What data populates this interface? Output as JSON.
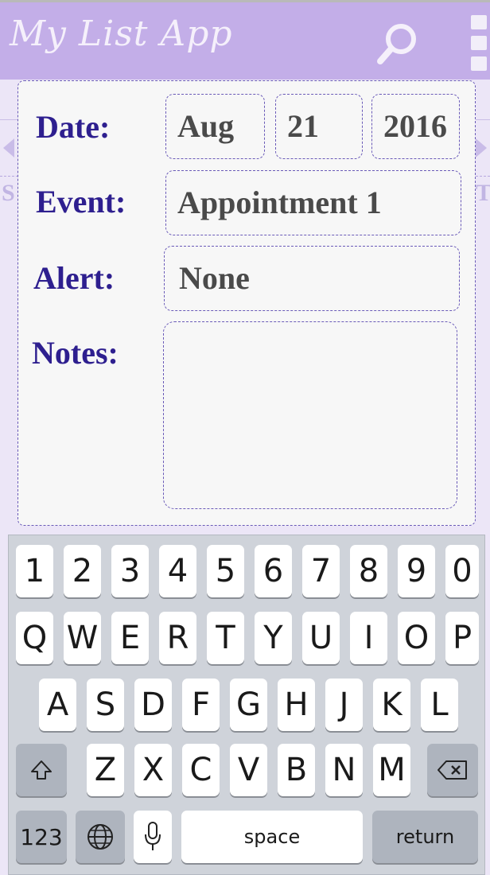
{
  "header": {
    "app_title": "My List App"
  },
  "background": {
    "left_letter": "S",
    "right_letter": "T"
  },
  "form": {
    "date_label": "Date:",
    "date_month": "Aug",
    "date_day": "21",
    "date_year": "2016",
    "event_label": "Event:",
    "event_value": "Appointment 1",
    "alert_label": "Alert:",
    "alert_value": "None",
    "notes_label": "Notes:",
    "notes_value": ""
  },
  "keyboard": {
    "row_numbers": [
      "1",
      "2",
      "3",
      "4",
      "5",
      "6",
      "7",
      "8",
      "9",
      "0"
    ],
    "row_top": [
      "Q",
      "W",
      "E",
      "R",
      "T",
      "Y",
      "U",
      "I",
      "O",
      "P"
    ],
    "row_middle": [
      "A",
      "S",
      "D",
      "F",
      "G",
      "H",
      "J",
      "K",
      "L"
    ],
    "row_bottom": [
      "Z",
      "X",
      "C",
      "V",
      "B",
      "N",
      "M"
    ],
    "numbers_key": "123",
    "space_key": "space",
    "return_key": "return"
  },
  "colors": {
    "header_bg": "#c3aee8",
    "label_color": "#2e1f8f",
    "field_border": "#6a5ab8"
  }
}
